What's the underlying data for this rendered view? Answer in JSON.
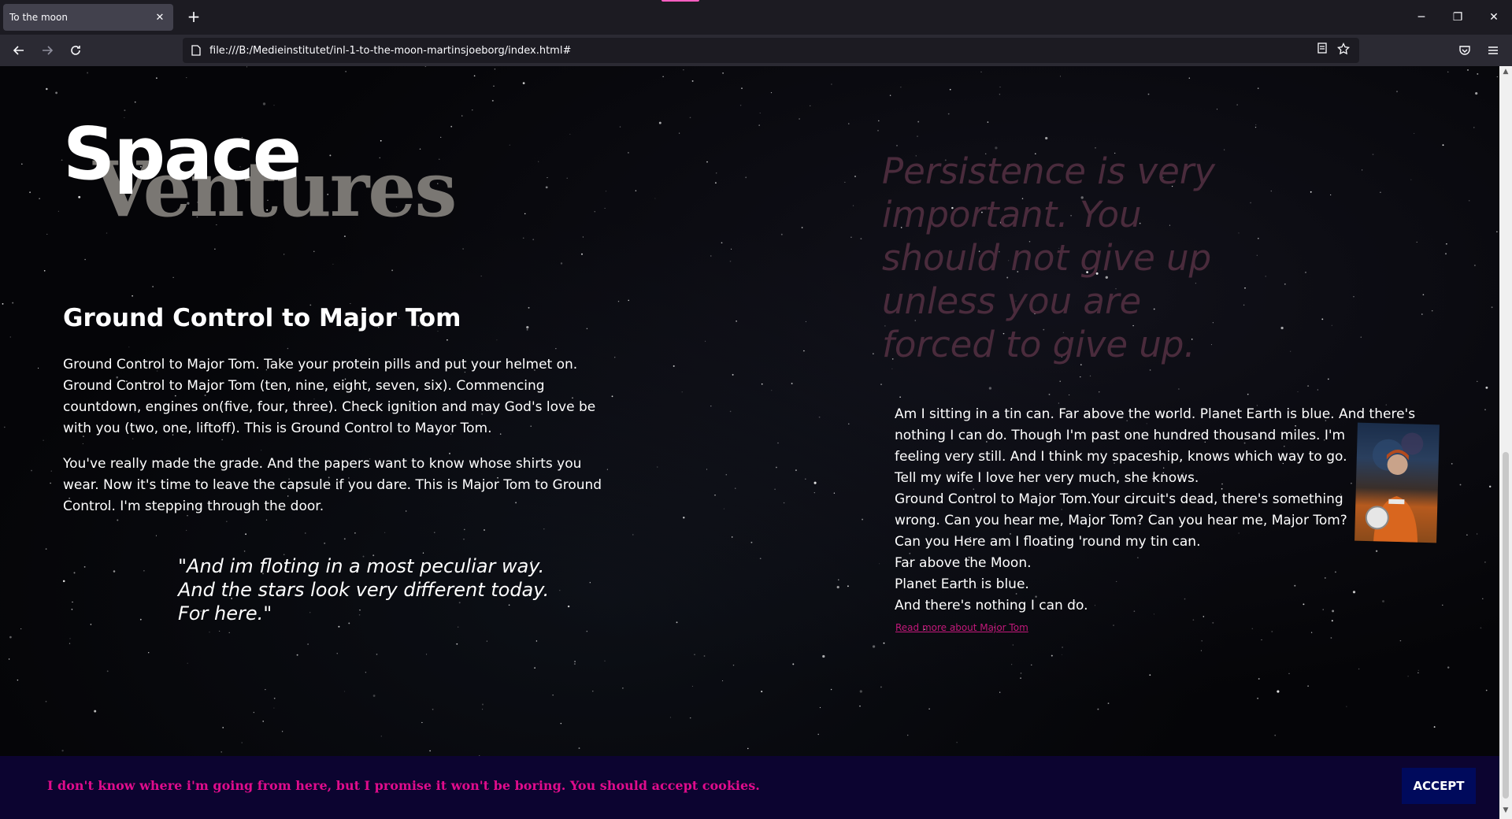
{
  "browser": {
    "tab_title": "To the moon",
    "tab_close": "✕",
    "new_tab": "+",
    "url": "file:///B:/Medieinstitutet/inl-1-to-the-moon-martinsjoeborg/index.html#",
    "window_controls": {
      "minimize": "─",
      "restore": "❐",
      "close": "✕"
    }
  },
  "page": {
    "logo": {
      "line1": "Space",
      "line2": "Ventures"
    },
    "heading": "Ground Control to Major Tom",
    "paragraph1": "Ground Control to Major Tom. Take your protein pills and put your helmet on. Ground Control to Major Tom (ten, nine, eight, seven, six). Commencing countdown, engines on(five, four, three). Check ignition and may God's love be with you (two, one, liftoff). This is Ground Control to Mayor Tom.",
    "paragraph2": "You've really made the grade. And the papers want to know whose shirts you wear. Now it's time to leave the capsule if you dare. This is Major Tom to Ground Control. I'm stepping through the door.",
    "quote_lines": [
      "\"And im floting in a most peculiar way.",
      " And the stars look very different today.",
      " For here.\""
    ],
    "big_quote": "Persistence is very important. You should not give up unless you are forced to give up.",
    "major_tom_lines": [
      "Am I sitting in a tin can. Far above the world. Planet Earth is blue. And there's",
      "nothing I can do. Though I'm past one hundred thousand miles. I'm",
      "feeling very still. And I think my spaceship, knows which way to go.",
      "Tell my wife I love her very much, she knows.",
      "Ground Control to Major Tom.Your circuit's dead, there's something",
      "wrong. Can you hear me, Major Tom? Can you hear me, Major Tom?",
      "Can you Here am I floating 'round my tin can.",
      "Far above the Moon.",
      "Planet Earth is blue.",
      "And there's nothing I can do."
    ],
    "read_more": "Read more about Major Tom"
  },
  "cookie": {
    "text": "I don't know where i'm going from here, but I promise it won't be boring. You should accept cookies.",
    "accept": "ACCEPT"
  },
  "colors": {
    "accent_pink": "#e00c8c",
    "cookie_bg": "#0c0430",
    "accept_bg": "#000a5c",
    "big_quote": "#4a2b3c"
  }
}
